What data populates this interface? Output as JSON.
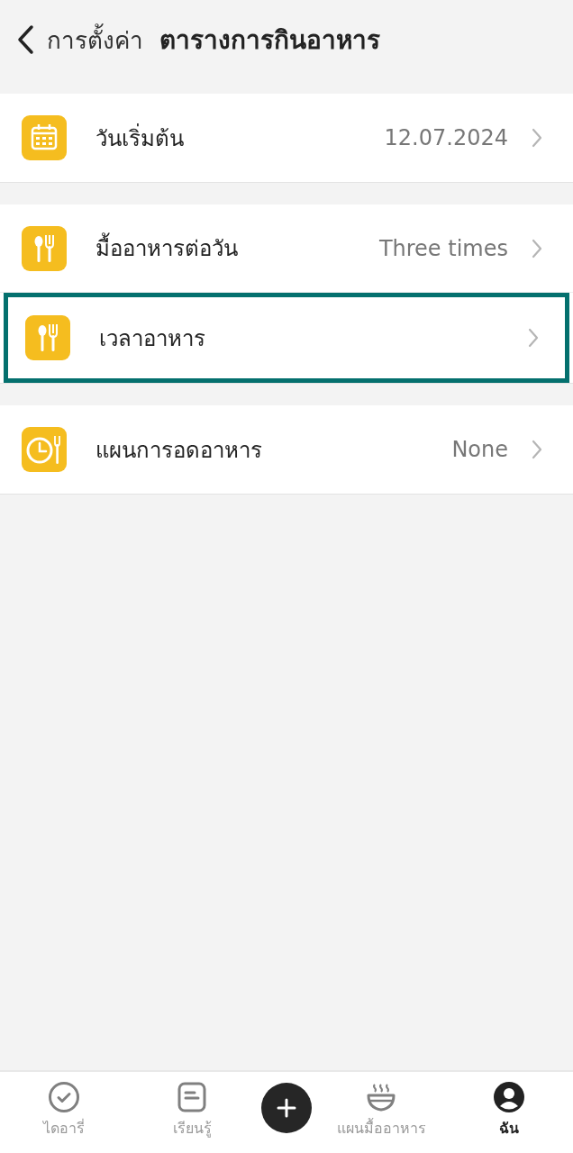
{
  "header": {
    "back_label": "การตั้งค่า",
    "title": "ตารางการกินอาหาร"
  },
  "sections": [
    {
      "items": [
        {
          "label": "วันเริ่มต้น",
          "value": "12.07.2024",
          "highlighted": false
        }
      ]
    },
    {
      "items": [
        {
          "label": "มื้ออาหารต่อวัน",
          "value": "Three times",
          "highlighted": false
        },
        {
          "label": "เวลาอาหาร",
          "highlighted": true
        }
      ]
    },
    {
      "items": [
        {
          "label": "แผนการอดอาหาร",
          "value": "None",
          "highlighted": false
        }
      ]
    }
  ],
  "bottom_nav": [
    {
      "kind": "tab",
      "label": "ไดอารี่",
      "selected": false
    },
    {
      "kind": "tab",
      "label": "เรียนรู้",
      "selected": false
    },
    {
      "kind": "add"
    },
    {
      "kind": "tab",
      "label": "แผนมื้ออาหาร",
      "selected": false
    },
    {
      "kind": "tab",
      "label": "ฉัน",
      "selected": true
    }
  ]
}
